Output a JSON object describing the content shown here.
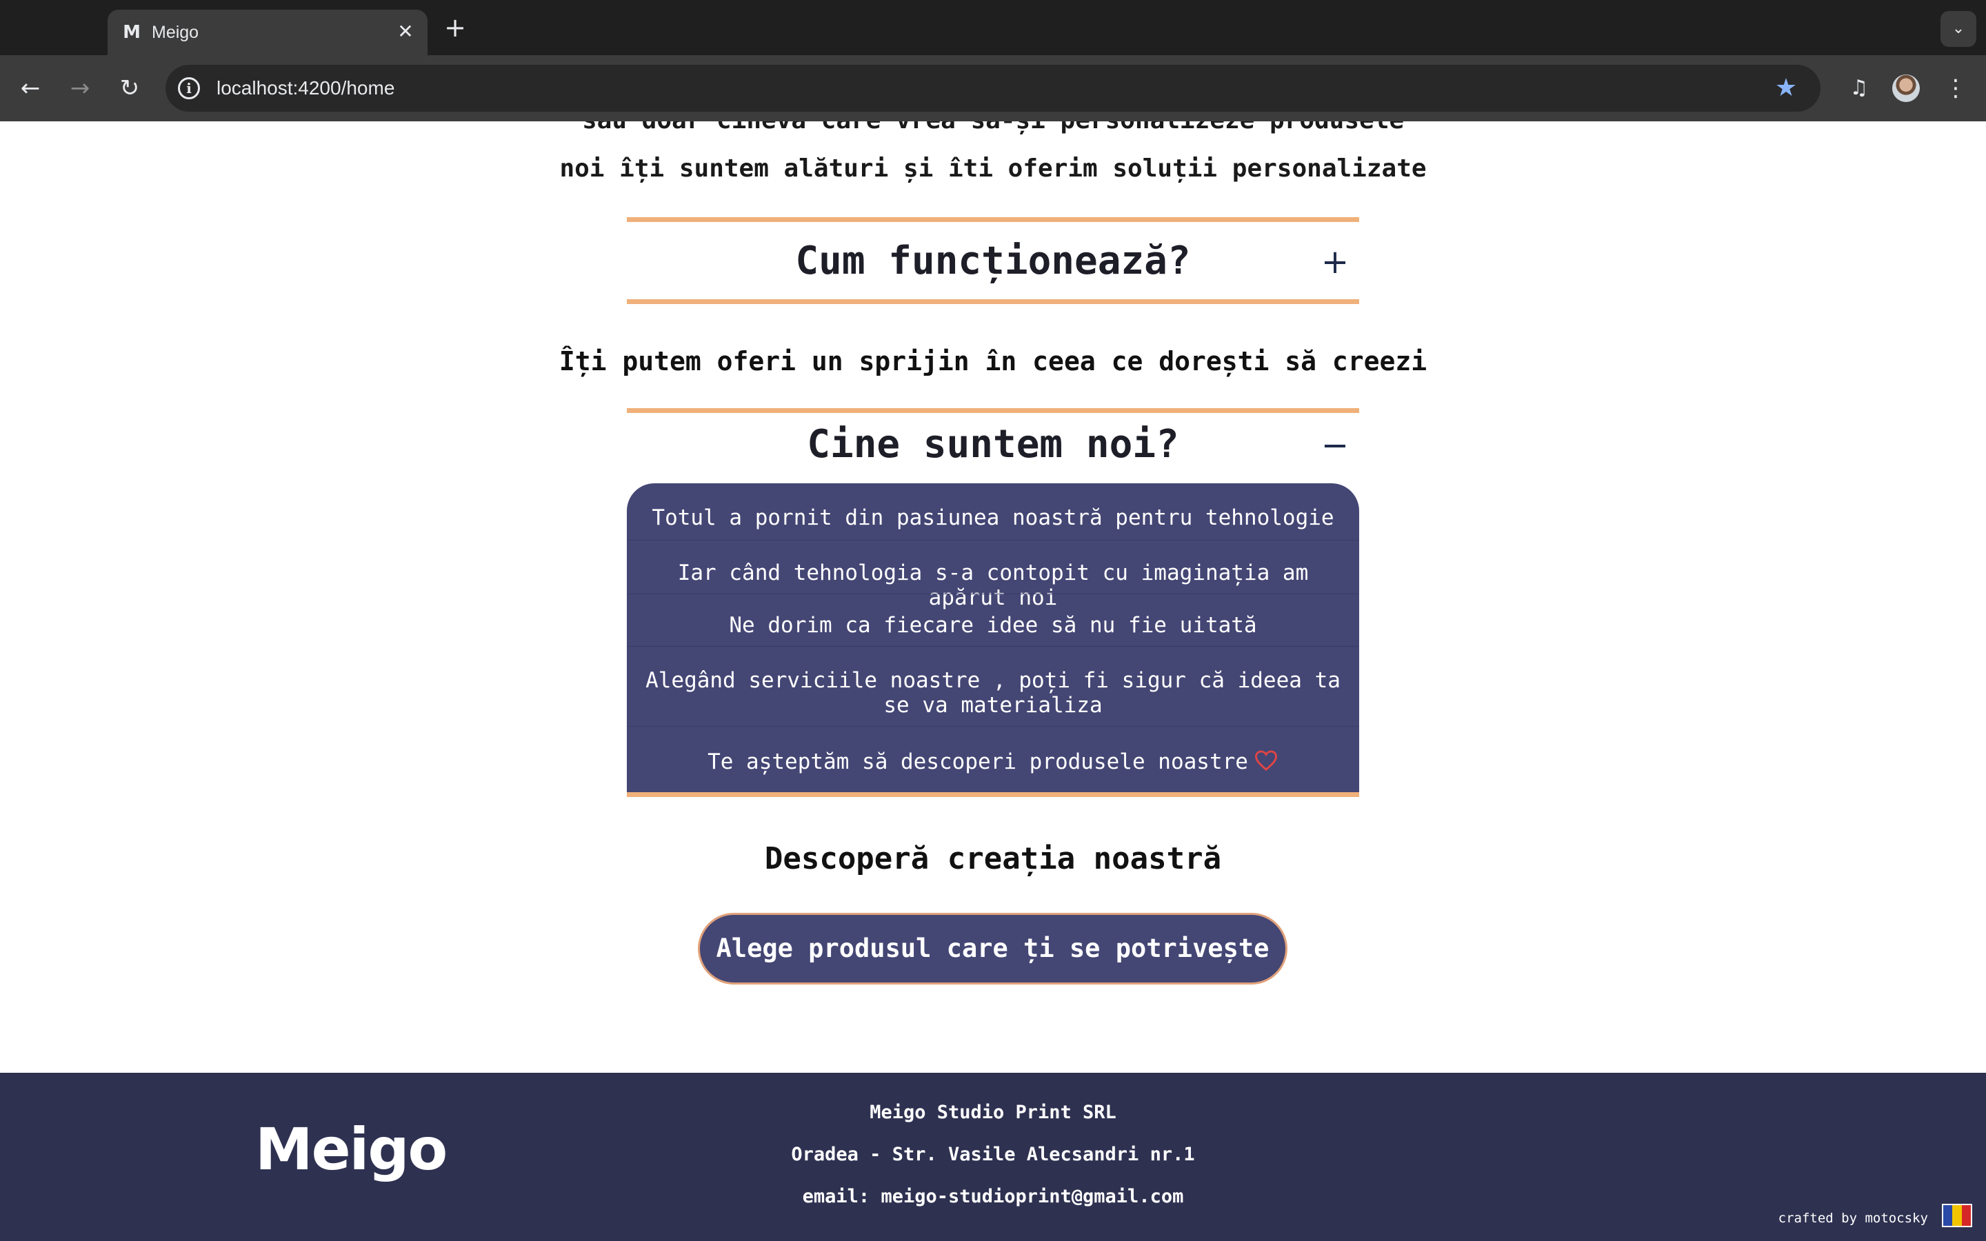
{
  "browser": {
    "tab_favicon": "M",
    "tab_title": "Meigo",
    "tab_close": "✕",
    "new_tab": "+",
    "tab_menu": "⌄",
    "back": "←",
    "forward": "→",
    "reload": "↻",
    "info": "i",
    "url": "localhost:4200/home",
    "star": "★",
    "media": "♫",
    "menu": "⋮"
  },
  "intro": {
    "line1": "sau doar cineva care vrea să-și personalizeze produsele",
    "line2": "noi îți suntem alături și îti oferim soluții personalizate"
  },
  "accordion1": {
    "title": "Cum funcționează?",
    "toggle": "+"
  },
  "subtitle": "Îți putem oferi un sprijin în ceea ce dorești să creezi",
  "accordion2": {
    "title": "Cine suntem noi?",
    "toggle": "−",
    "lines": [
      "Totul a pornit din pasiunea noastră pentru tehnologie",
      "Iar când tehnologia s-a contopit cu imaginația am apărut noi",
      "Ne dorim ca fiecare idee să nu fie uitată",
      "Alegând serviciile noastre , poți fi sigur că ideea ta se va materializa",
      "Te așteptăm să descoperi produsele noastre"
    ]
  },
  "discover": {
    "heading": "Descoperă creația noastră",
    "cta": "Alege produsul care ți se potrivește"
  },
  "footer": {
    "logo": "Meigo",
    "company": "Meigo Studio Print SRL",
    "address": "Oradea - Str. Vasile Alecsandri nr.1",
    "email": "email: meigo-studioprint@gmail.com",
    "crafted": "crafted by motocsky",
    "flag_colors": [
      "#2b4aa8",
      "#f2c500",
      "#d62828"
    ]
  },
  "colors": {
    "accent": "#f0b07a",
    "panel": "#444674",
    "footer": "#2e3150",
    "heart": "#e04545"
  }
}
